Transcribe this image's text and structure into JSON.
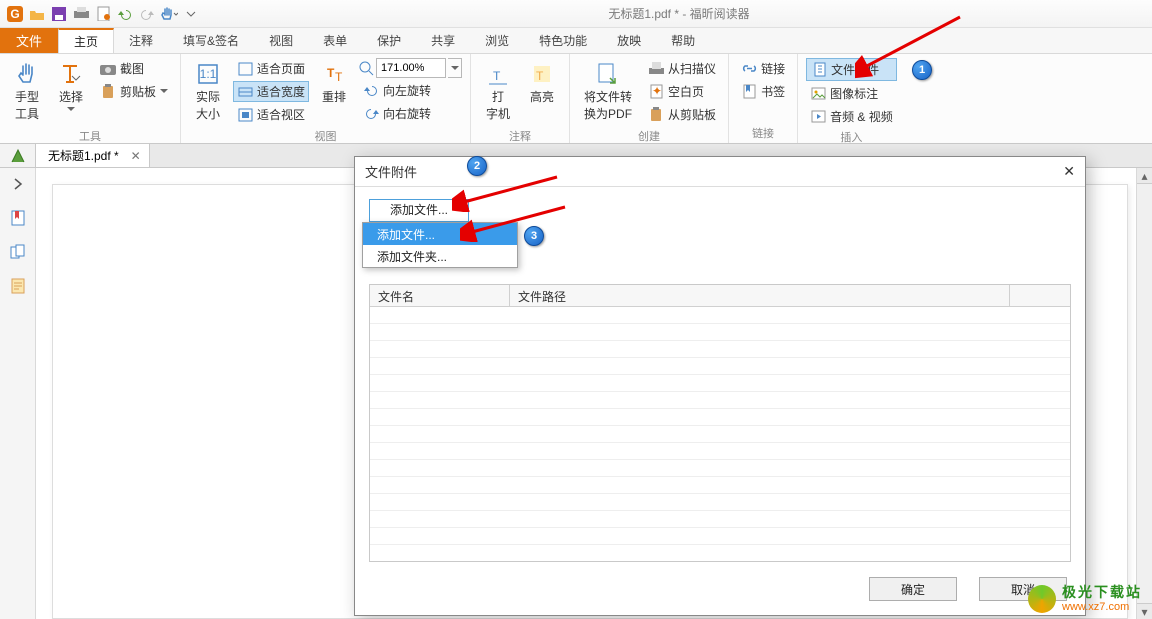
{
  "titlebar": {
    "title": "无标题1.pdf * - 福昕阅读器"
  },
  "menubar": {
    "file": "文件",
    "items": [
      "主页",
      "注释",
      "填写&签名",
      "视图",
      "表单",
      "保护",
      "共享",
      "浏览",
      "特色功能",
      "放映",
      "帮助"
    ],
    "active_index": 0
  },
  "ribbon": {
    "groups": {
      "tools": {
        "label": "工具",
        "hand": "手型\n工具",
        "select": "选择",
        "snapshot": "截图",
        "clipboard": "剪贴板"
      },
      "view": {
        "label": "视图",
        "actual": "实际\n大小",
        "fit_page": "适合页面",
        "fit_width": "适合宽度",
        "fit_view": "适合视区",
        "reflow": "重排",
        "rotate_left": "向左旋转",
        "rotate_right": "向右旋转",
        "zoom": "171.00%"
      },
      "annotate": {
        "label": "注释",
        "typewriter": "打\n字机",
        "highlight": "高亮"
      },
      "create": {
        "label": "创建",
        "convert": "将文件转\n换为PDF",
        "scanner": "从扫描仪",
        "blank": "空白页",
        "clipboard": "从剪贴板"
      },
      "link": {
        "label": "链接",
        "hyperlink": "链接",
        "bookmark": "书签"
      },
      "insert": {
        "label": "插入",
        "attachment": "文件附件",
        "image": "图像标注",
        "media": "音频 & 视频"
      }
    }
  },
  "doctab": {
    "name": "无标题1.pdf *"
  },
  "dialog": {
    "title": "文件附件",
    "add_btn": "添加文件...",
    "menu": {
      "add_file": "添加文件...",
      "add_folder": "添加文件夹..."
    },
    "columns": {
      "name": "文件名",
      "path": "文件路径"
    },
    "ok": "确定",
    "cancel": "取消",
    "residual": "'。"
  },
  "annotations": {
    "c1": "1",
    "c2": "2",
    "c3": "3"
  },
  "watermark": {
    "cn": "极光下载站",
    "url": "www.xz7.com"
  }
}
